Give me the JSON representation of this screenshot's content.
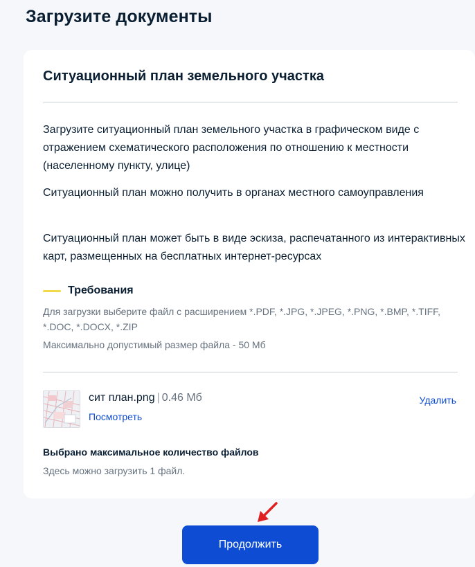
{
  "page": {
    "title": "Загрузите документы"
  },
  "card": {
    "title": "Ситуационный план земельного участка",
    "paragraphs": [
      "Загрузите ситуационный план земельного участка в графическом виде с отражением схематического расположения по отношению к местности (населенному пункту, улице)",
      "Ситуационный план можно получить в органах местного самоуправления",
      "Ситуационный план может быть в виде эскиза, распечатанного из интерактивных карт, размещенных на бесплатных интернет-ресурсах"
    ],
    "requirements": {
      "title": "Требования",
      "extensions": "Для загрузки выберите файл с расширением *.PDF, *.JPG, *.JPEG, *.PNG, *.BMP, *.TIFF, *.DOC, *.DOCX, *.ZIP",
      "max_size": "Максимально допустимый размер файла - 50 Мб"
    },
    "file": {
      "name": "сит план.png",
      "separator": "|",
      "size": "0.46 Мб",
      "view_label": "Посмотреть",
      "delete_label": "Удалить",
      "thumbnail_icon": "map-thumbnail-icon"
    },
    "max_files": {
      "title": "Выбрано максимальное количество файлов",
      "text": "Здесь можно загрузить 1 файл."
    }
  },
  "actions": {
    "continue_label": "Продолжить"
  },
  "colors": {
    "accent": "#0d4cd3",
    "requirement_marker": "#f2d94a",
    "annotation_arrow": "#e02020",
    "text": "#0b1f33",
    "muted": "#66727f"
  }
}
